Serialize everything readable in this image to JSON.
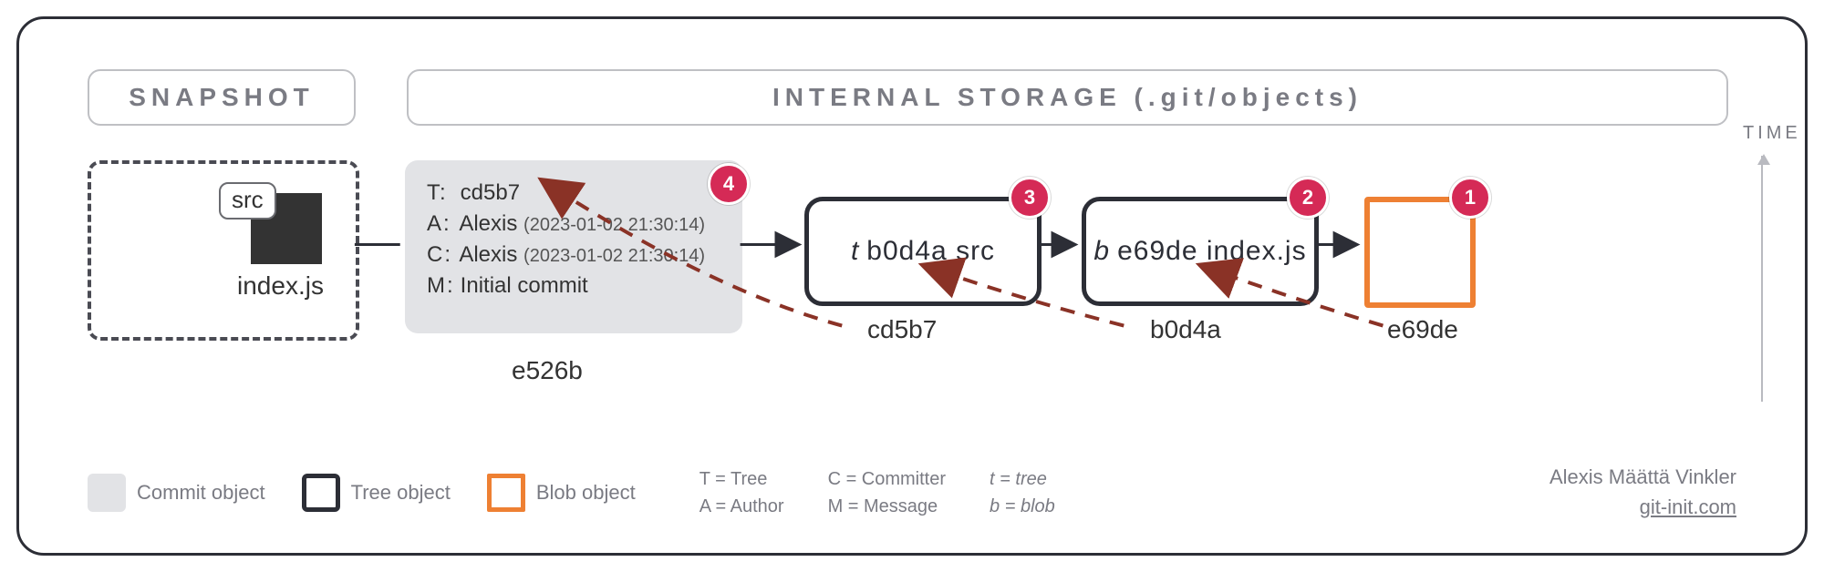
{
  "titles": {
    "snapshot": "SNAPSHOT",
    "storage": "INTERNAL STORAGE (.git/objects)"
  },
  "snapshot": {
    "folder_label": "src",
    "file_label": "index.js"
  },
  "commit": {
    "tree_key": "T:",
    "tree_hash": "cd5b7",
    "author_key": "A:",
    "author_name": "Alexis",
    "author_ts": "(2023-01-02 21:30:14)",
    "committer_key": "C:",
    "committer_name": "Alexis",
    "committer_ts": "(2023-01-02 21:30:14)",
    "message_key": "M:",
    "message": "Initial commit",
    "hash": "e526b"
  },
  "tree_root": {
    "type": "t",
    "entry_hash": "b0d4a",
    "entry_name": "src",
    "hash": "cd5b7"
  },
  "tree_src": {
    "type": "b",
    "entry_hash": "e69de",
    "entry_name": "index.js",
    "hash": "b0d4a"
  },
  "blob": {
    "hash": "e69de"
  },
  "badges": {
    "b1": "1",
    "b2": "2",
    "b3": "3",
    "b4": "4"
  },
  "time_label": "TIME",
  "legend": {
    "commit": "Commit object",
    "tree": "Tree object",
    "blob": "Blob object",
    "T": "T = Tree",
    "A": "A = Author",
    "C": "C = Committer",
    "M": "M = Message",
    "t": "t = tree",
    "b": "b = blob"
  },
  "credit": {
    "author": "Alexis Määttä Vinkler",
    "site": "git-init.com"
  }
}
